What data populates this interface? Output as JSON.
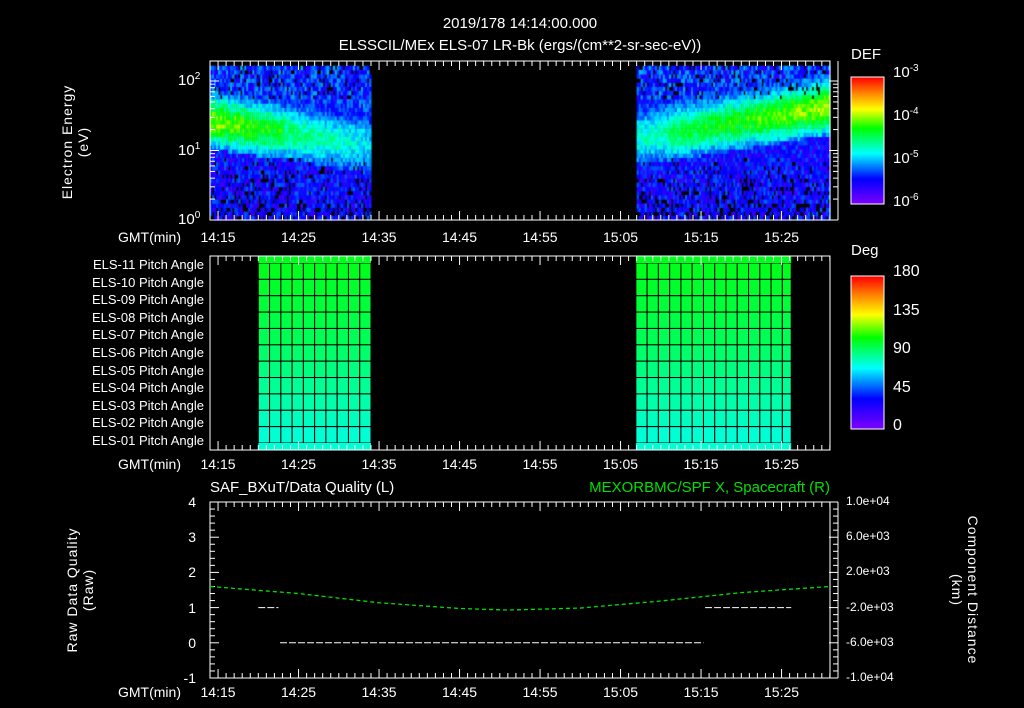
{
  "header": {
    "datetime": "2019/178 14:14:00.000"
  },
  "chart_data": [
    {
      "type": "heatmap",
      "title": "ELSSCIL/MEx ELS-07 LR-Bk  (ergs/(cm**2-sr-sec-eV))",
      "ylabel": [
        "Electron Energy",
        "(eV)"
      ],
      "xlabel": "GMT(min)",
      "x_ticks": [
        "14:15",
        "14:25",
        "14:35",
        "14:45",
        "14:55",
        "15:05",
        "15:15",
        "15:25"
      ],
      "y_ticks": [
        {
          "base": "10",
          "exp": "0"
        },
        {
          "base": "10",
          "exp": "1"
        },
        {
          "base": "10",
          "exp": "2"
        }
      ],
      "y_scale": "log",
      "ylim_eV": [
        1,
        150
      ],
      "xlim_min": [
        -1,
        76
      ],
      "data_intervals_min": [
        [
          -1,
          18.8
        ],
        [
          51.9,
          76
        ]
      ],
      "peak_energy_log10": {
        "start": 1.4,
        "gap_start": 1.05,
        "resume": 1.15,
        "end": 1.55
      },
      "colorbar": {
        "label": "DEF",
        "scale": "log",
        "ticks": [
          {
            "base": "10",
            "exp": "-3"
          },
          {
            "base": "10",
            "exp": "-4"
          },
          {
            "base": "10",
            "exp": "-5"
          },
          {
            "base": "10",
            "exp": "-6"
          }
        ],
        "range_log10": [
          -6.3,
          -3
        ]
      }
    },
    {
      "type": "heatmap",
      "xlabel": "GMT(min)",
      "x_ticks": [
        "14:15",
        "14:25",
        "14:35",
        "14:45",
        "14:55",
        "15:05",
        "15:15",
        "15:25"
      ],
      "rows": [
        "ELS-11 Pitch Angle",
        "ELS-10 Pitch Angle",
        "ELS-09 Pitch Angle",
        "ELS-08 Pitch Angle",
        "ELS-07 Pitch Angle",
        "ELS-06 Pitch Angle",
        "ELS-05 Pitch Angle",
        "ELS-04 Pitch Angle",
        "ELS-03 Pitch Angle",
        "ELS-02 Pitch Angle",
        "ELS-01 Pitch Angle"
      ],
      "row_values_deg": [
        104,
        102,
        100,
        98,
        96,
        93,
        90,
        87,
        84,
        81,
        78
      ],
      "data_intervals_min": [
        [
          5,
          19
        ],
        [
          51.9,
          71.2
        ]
      ],
      "colorbar": {
        "label": "Deg",
        "ticks": [
          "180",
          "135",
          "90",
          "45",
          "0"
        ],
        "range": [
          0,
          180
        ]
      }
    },
    {
      "type": "line",
      "title_left": "SAF_BXuT/Data Quality (L)",
      "title_right": "MEXORBMC/SPF X, Spacecraft (R)",
      "ylabel_left": [
        "Raw Data Quality",
        "(Raw)"
      ],
      "ylabel_right": [
        "Component Distance",
        "(km)"
      ],
      "xlabel": "GMT(min)",
      "x_ticks": [
        "14:15",
        "14:25",
        "14:35",
        "14:45",
        "14:55",
        "15:05",
        "15:15",
        "15:25"
      ],
      "y_left_ticks": [
        "4",
        "3",
        "2",
        "1",
        "0",
        "-1"
      ],
      "ylim_left": [
        -1,
        4
      ],
      "y_right_ticks": [
        "1.0e+04",
        "6.0e+03",
        "2.0e+03",
        "-2.0e+03",
        "-6.0e+03",
        "-1.0e+04"
      ],
      "ylim_right": [
        -10000,
        10000
      ],
      "series": [
        {
          "name": "Data Quality",
          "axis": "left",
          "color": "#ffffff",
          "segments": [
            {
              "x": [
                5,
                7.5
              ],
              "y": 1
            },
            {
              "x": [
                7.7,
                60.3
              ],
              "y": 0
            },
            {
              "x": [
                60.5,
                71.2
              ],
              "y": 1
            }
          ]
        },
        {
          "name": "SPF X",
          "axis": "right",
          "color": "#00e000",
          "x": [
            -1,
            10,
            20,
            30,
            36,
            45,
            55,
            65,
            76
          ],
          "y": [
            400,
            -400,
            -1450,
            -2100,
            -2280,
            -2050,
            -1250,
            -300,
            400
          ]
        }
      ]
    }
  ]
}
